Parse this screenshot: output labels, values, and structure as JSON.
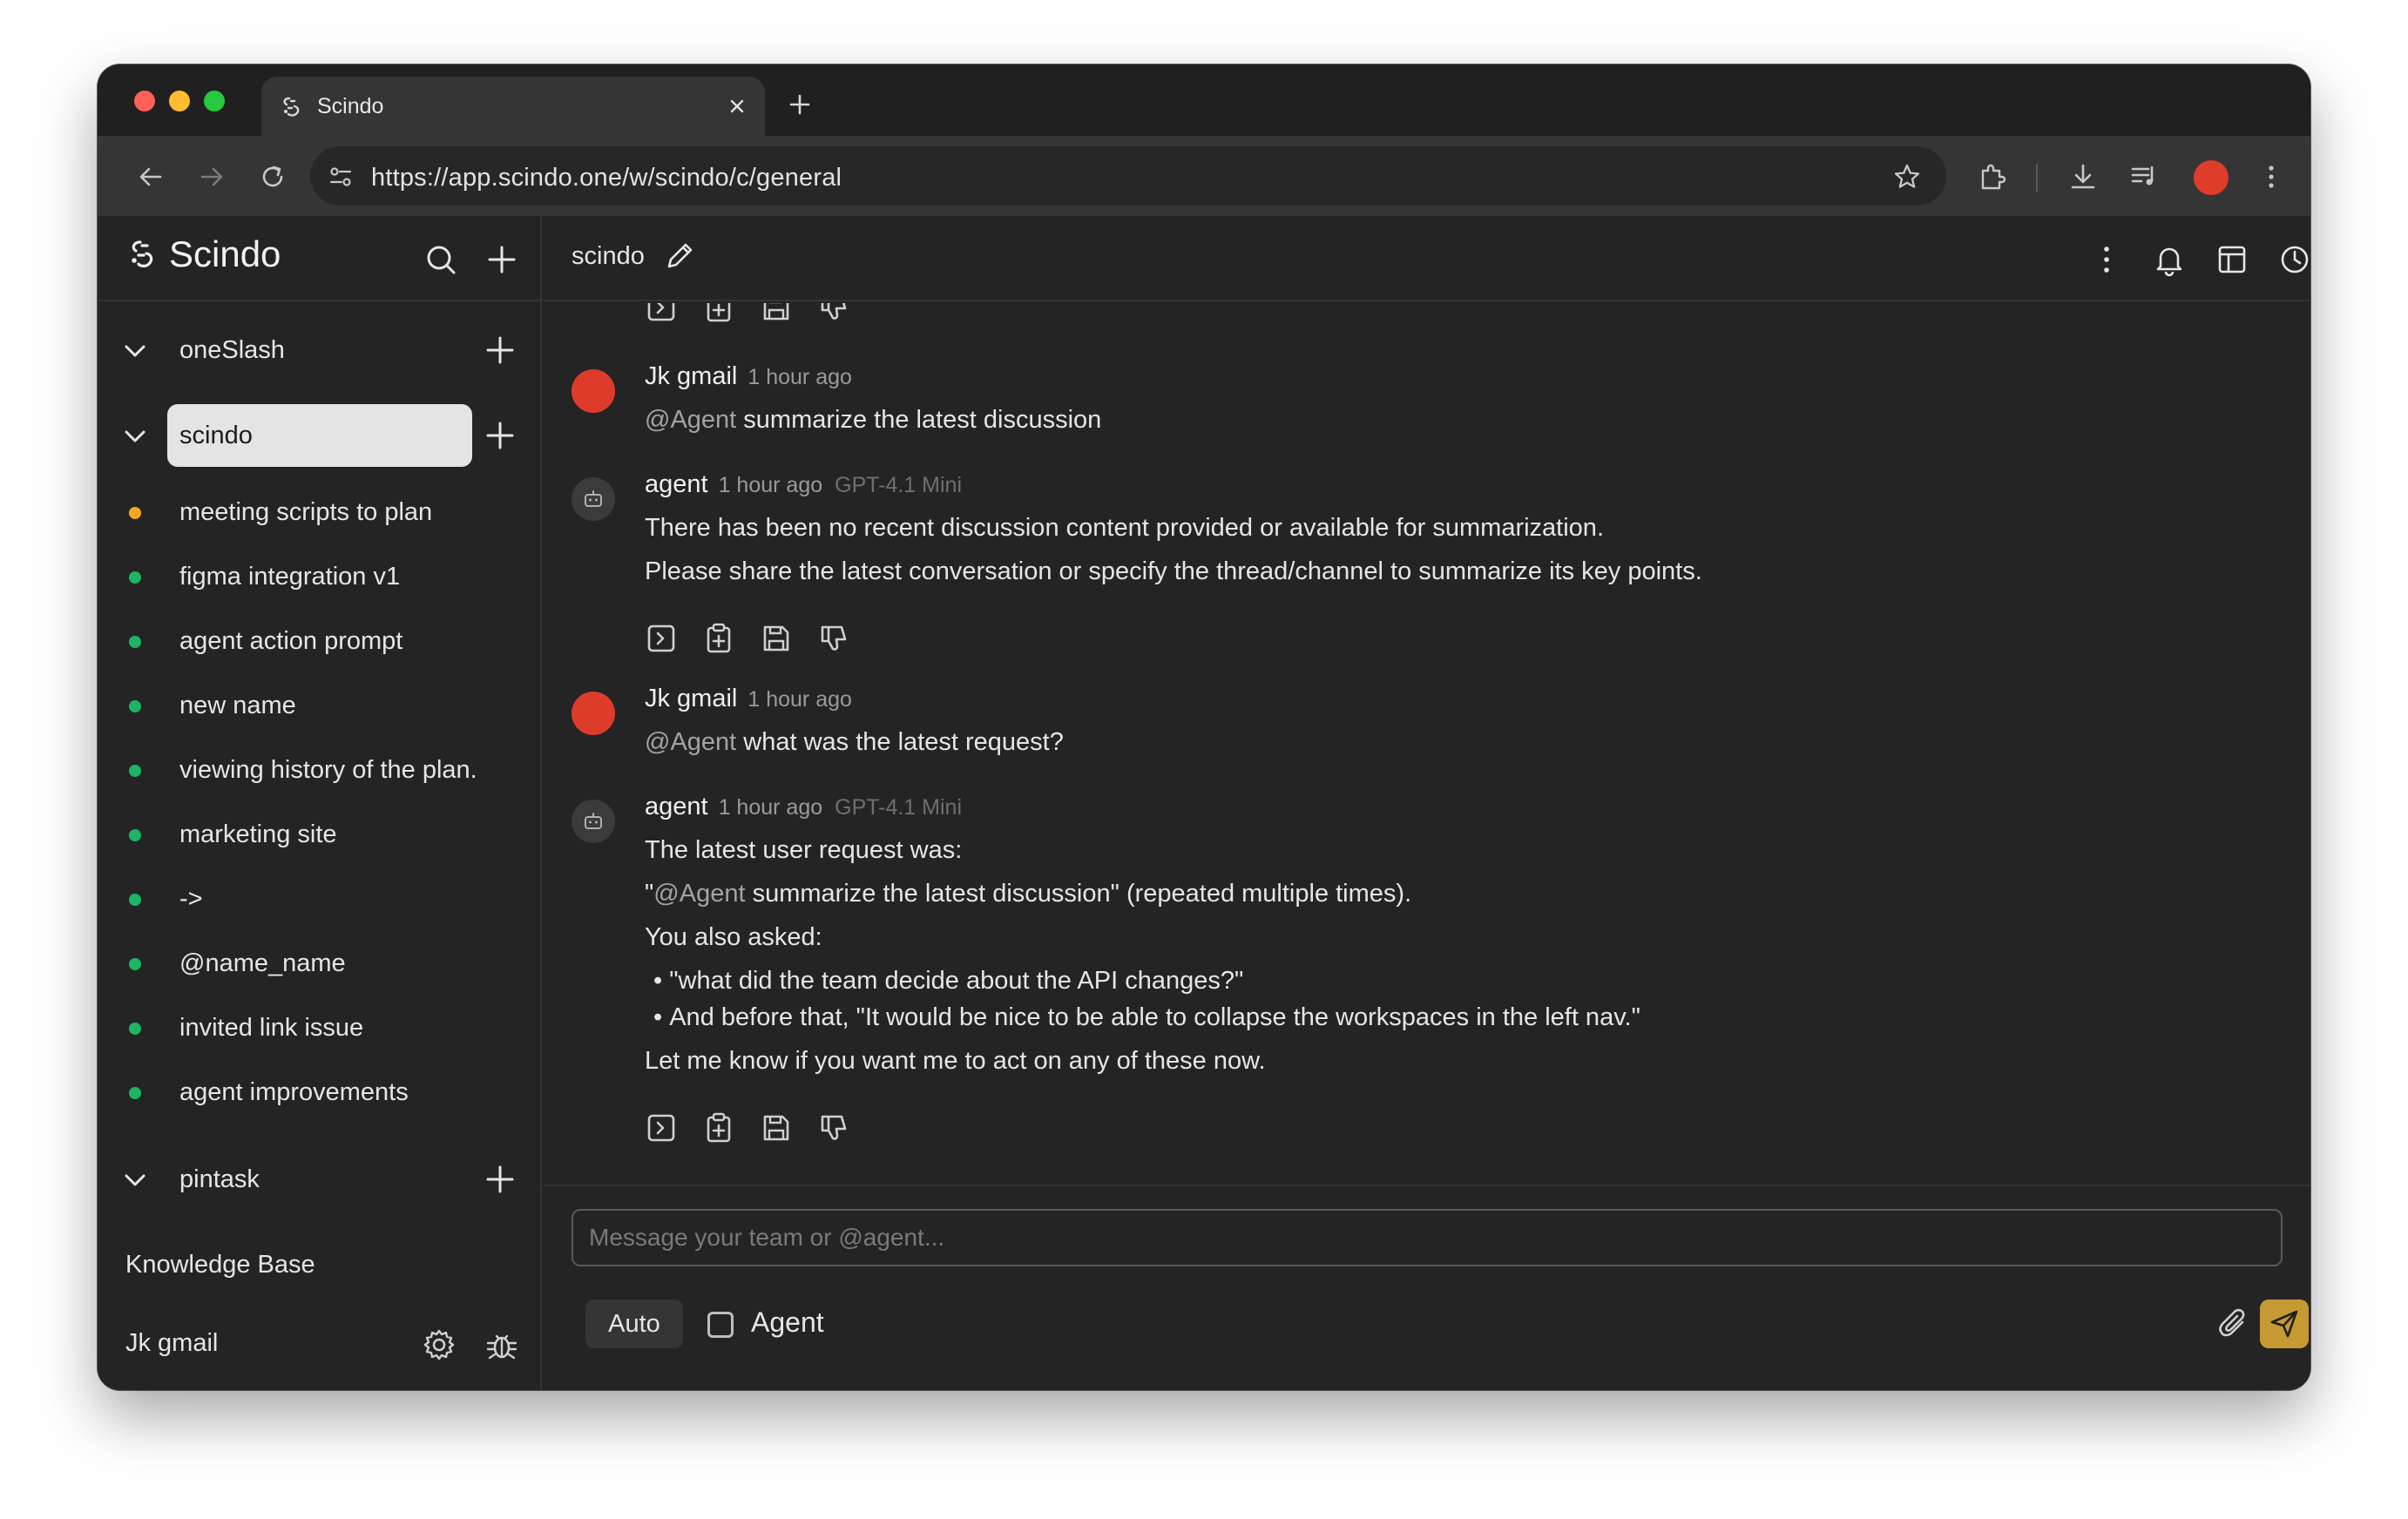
{
  "browser": {
    "tab_title": "Scindo",
    "url": "https://app.scindo.one/w/scindo/c/general"
  },
  "sidebar": {
    "brand": "Scindo",
    "workspaces": [
      {
        "name": "oneSlash"
      },
      {
        "name": "scindo",
        "selected": true
      },
      {
        "name": "pintask"
      }
    ],
    "threads": [
      {
        "label": "meeting scripts to plan",
        "status_color": "#f5a623"
      },
      {
        "label": "figma integration v1",
        "status_color": "#1db464"
      },
      {
        "label": "agent action prompt",
        "status_color": "#1db464"
      },
      {
        "label": "new name",
        "status_color": "#1db464"
      },
      {
        "label": "viewing history of the plan.",
        "status_color": "#1db464"
      },
      {
        "label": "marketing site",
        "status_color": "#1db464"
      },
      {
        "label": "->",
        "status_color": "#1db464"
      },
      {
        "label": "@name_name",
        "status_color": "#1db464"
      },
      {
        "label": "invited link issue",
        "status_color": "#1db464"
      },
      {
        "label": "agent improvements",
        "status_color": "#1db464"
      }
    ],
    "knowledge_base": "Knowledge Base",
    "user_name": "Jk gmail"
  },
  "main": {
    "channel_title": "scindo",
    "messages": [
      {
        "author": "Jk gmail",
        "time": "1 hour ago",
        "mention": "@Agent",
        "text": " summarize the latest discussion"
      },
      {
        "author": "agent",
        "time": "1 hour ago",
        "model": "GPT-4.1 Mini",
        "lines": [
          "There has been no recent discussion content provided or available for summarization.",
          "Please share the latest conversation or specify the thread/channel to summarize its key points."
        ]
      },
      {
        "author": "Jk gmail",
        "time": "1 hour ago",
        "mention": "@Agent",
        "text": " what was the latest request?"
      },
      {
        "author": "agent",
        "time": "1 hour ago",
        "model": "GPT-4.1 Mini",
        "line1": "The latest user request was:",
        "line2_prefix": "\"",
        "line2_mention": "@Agent",
        "line2_rest": " summarize the latest discussion\" (repeated multiple times).",
        "line3": "You also asked:",
        "bullets": [
          "\"what did the team decide about the API changes?\"",
          "And before that, \"It would be nice to be able to collapse the workspaces in the left nav.\""
        ],
        "line4": "Let me know if you want me to act on any of these now."
      }
    ]
  },
  "composer": {
    "placeholder": "Message your team or @agent...",
    "mode_label": "Auto",
    "agent_label": "Agent",
    "agent_checked": false
  },
  "colors": {
    "accent_send": "#c59a33",
    "human_avatar": "#df3b2a",
    "status_online": "#1db464",
    "status_pending": "#f5a623"
  }
}
